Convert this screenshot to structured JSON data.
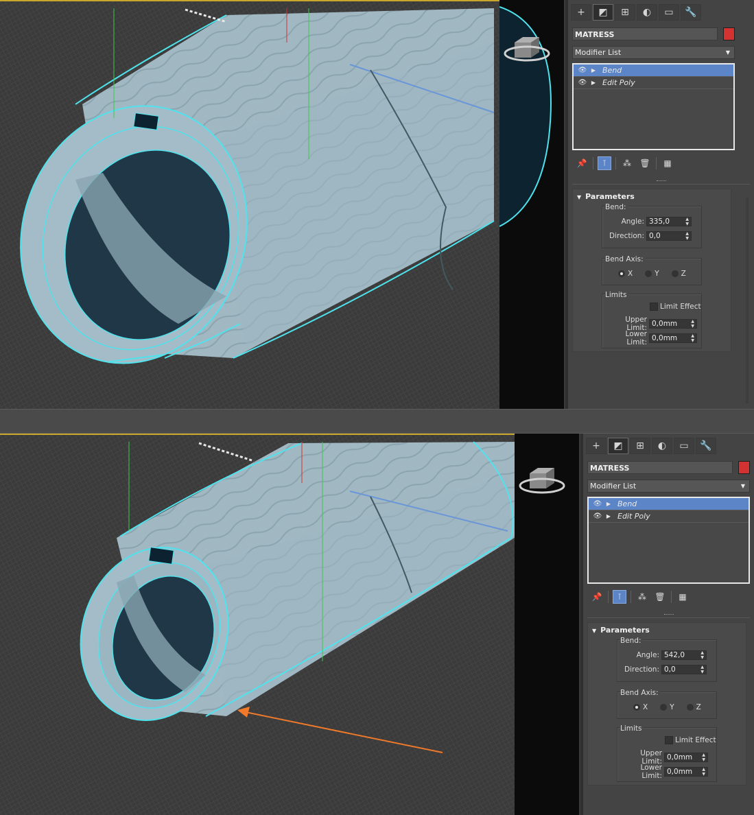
{
  "top": {
    "command_tabs": [
      {
        "icon": "create-icon",
        "glyph": "+"
      },
      {
        "icon": "modify-icon",
        "glyph": "◩"
      },
      {
        "icon": "hierarchy-icon",
        "glyph": "⊞"
      },
      {
        "icon": "motion-icon",
        "glyph": "◐"
      },
      {
        "icon": "display-icon",
        "glyph": "▭"
      },
      {
        "icon": "utilities-icon",
        "glyph": "🔧"
      }
    ],
    "object_name": "MATRESS",
    "object_color": "#d23232",
    "modifier_list_label": "Modifier List",
    "stack": [
      {
        "label": "Bend",
        "selected": true
      },
      {
        "label": "Edit Poly",
        "selected": false
      }
    ],
    "rollout_title": "Parameters",
    "bend_group": "Bend:",
    "angle_label": "Angle:",
    "angle_value": "335,0",
    "direction_label": "Direction:",
    "direction_value": "0,0",
    "axis_group": "Bend Axis:",
    "axis_x": "X",
    "axis_y": "Y",
    "axis_z": "Z",
    "selected_axis": "X",
    "limits_group": "Limits",
    "limit_effect_label": "Limit Effect",
    "upper_limit_label": "Upper Limit:",
    "upper_limit_value": "0,0mm",
    "lower_limit_label": "Lower Limit:",
    "lower_limit_value": "0,0mm"
  },
  "bottom": {
    "command_tabs": [
      {
        "icon": "create-icon",
        "glyph": "+"
      },
      {
        "icon": "modify-icon",
        "glyph": "◩"
      },
      {
        "icon": "hierarchy-icon",
        "glyph": "⊞"
      },
      {
        "icon": "motion-icon",
        "glyph": "◐"
      },
      {
        "icon": "display-icon",
        "glyph": "▭"
      },
      {
        "icon": "utilities-icon",
        "glyph": "🔧"
      }
    ],
    "object_name": "MATRESS",
    "object_color": "#d23232",
    "modifier_list_label": "Modifier List",
    "stack": [
      {
        "label": "Bend",
        "selected": true
      },
      {
        "label": "Edit Poly",
        "selected": false
      }
    ],
    "rollout_title": "Parameters",
    "bend_group": "Bend:",
    "angle_label": "Angle:",
    "angle_value": "542,0",
    "direction_label": "Direction:",
    "direction_value": "0,0",
    "axis_group": "Bend Axis:",
    "axis_x": "X",
    "axis_y": "Y",
    "axis_z": "Z",
    "selected_axis": "X",
    "limits_group": "Limits",
    "limit_effect_label": "Limit Effect",
    "upper_limit_label": "Upper Limit:",
    "upper_limit_value": "0,0mm",
    "lower_limit_label": "Lower Limit:",
    "lower_limit_value": "0,0mm"
  },
  "colors": {
    "selection_outline": "#4fe3ee",
    "viewport_border": "#c8a72a",
    "annotation_arrow": "#f07a2a",
    "stack_selected": "#5b85c6"
  }
}
